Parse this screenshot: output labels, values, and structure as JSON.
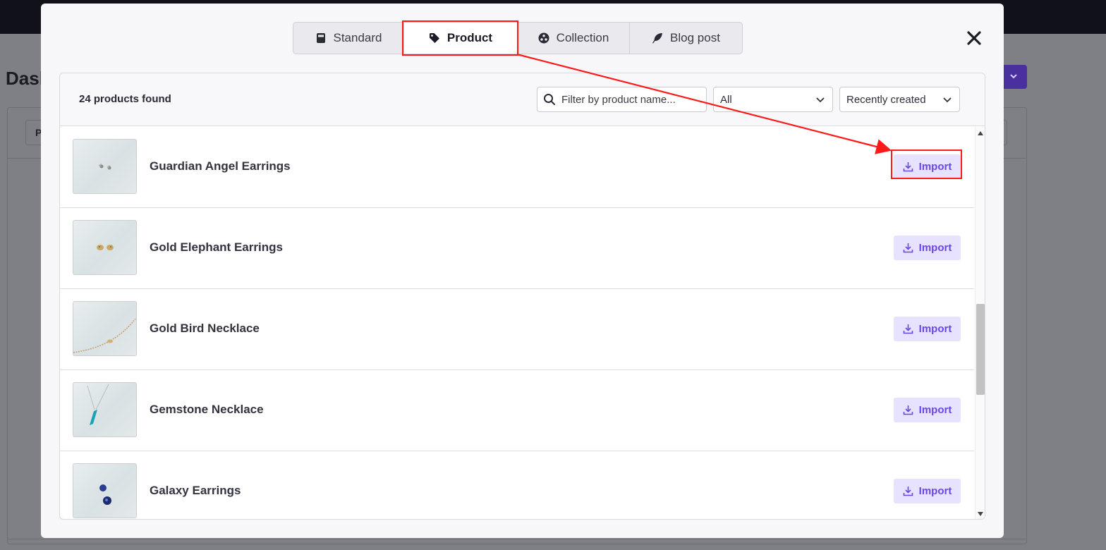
{
  "background": {
    "title": "Dash",
    "chip_label": "P",
    "dropdown_icon": "chevron-down-icon"
  },
  "modal": {
    "tabs": [
      {
        "label": "Standard",
        "icon": "page-icon",
        "active": false
      },
      {
        "label": "Product",
        "icon": "tag-icon",
        "active": true
      },
      {
        "label": "Collection",
        "icon": "collection-icon",
        "active": false
      },
      {
        "label": "Blog post",
        "icon": "feather-icon",
        "active": false
      }
    ],
    "close_icon": "close-icon"
  },
  "panel": {
    "count_label": "24 products found",
    "search": {
      "placeholder": "Filter by product name...",
      "value": "",
      "icon": "search-icon"
    },
    "status_filter": {
      "selected": "All"
    },
    "sort": {
      "selected": "Recently created"
    }
  },
  "products": [
    {
      "name": "Guardian Angel Earrings",
      "action": "Import"
    },
    {
      "name": "Gold Elephant Earrings",
      "action": "Import"
    },
    {
      "name": "Gold Bird Necklace",
      "action": "Import"
    },
    {
      "name": "Gemstone Necklace",
      "action": "Import"
    },
    {
      "name": "Galaxy Earrings",
      "action": "Import"
    }
  ],
  "colors": {
    "accent": "#6a46e6",
    "import_bg": "#e6e2ff",
    "annotation": "#ff1a1a"
  }
}
